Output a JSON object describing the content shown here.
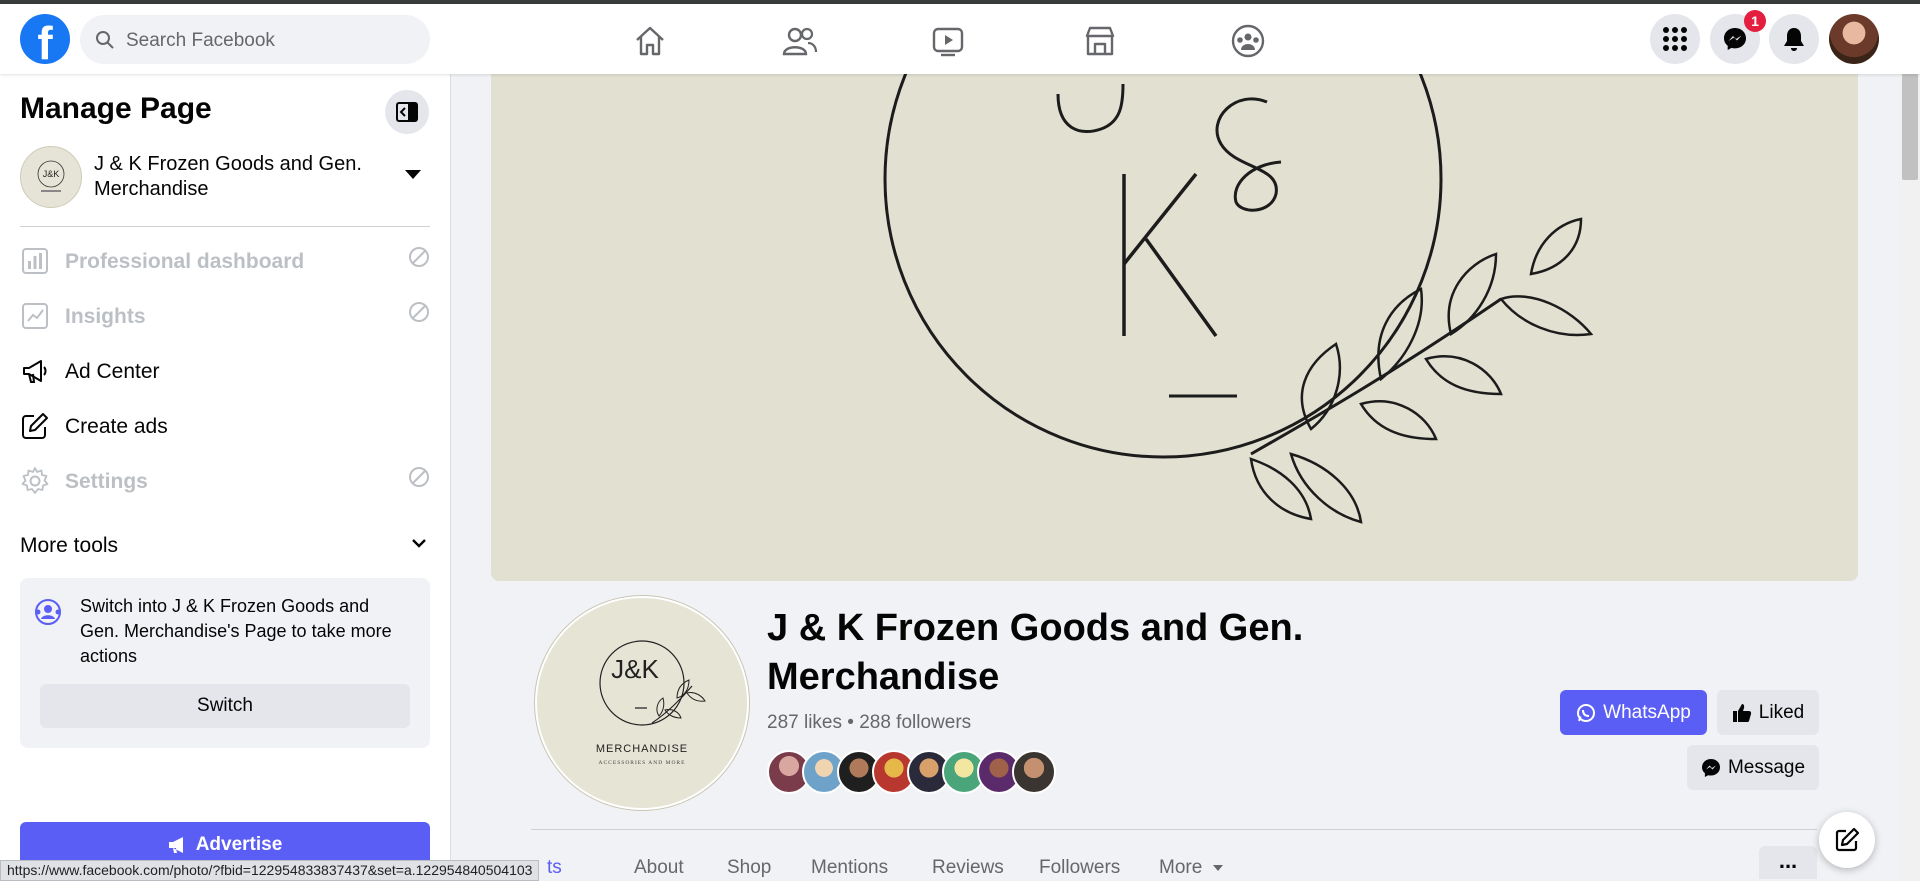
{
  "search": {
    "placeholder": "Search Facebook"
  },
  "navbar": {
    "icons": [
      "home-icon",
      "friends-icon",
      "watch-icon",
      "marketplace-icon",
      "groups-icon"
    ],
    "messenger_badge": "1"
  },
  "sidebar": {
    "title": "Manage Page",
    "page_name": "J & K Frozen Goods and Gen. Merchandise",
    "items": [
      {
        "label": "Professional dashboard",
        "icon": "dashboard-icon",
        "disabled": true
      },
      {
        "label": "Insights",
        "icon": "insights-icon",
        "disabled": true
      },
      {
        "label": "Ad Center",
        "icon": "megaphone-icon",
        "disabled": false
      },
      {
        "label": "Create ads",
        "icon": "edit-icon",
        "disabled": false
      },
      {
        "label": "Settings",
        "icon": "gear-icon",
        "disabled": true
      }
    ],
    "more_tools": "More tools",
    "switch_text": "Switch into J & K Frozen Goods and Gen. Merchandise's Page to take more actions",
    "switch_button": "Switch",
    "advertise_button": "Advertise"
  },
  "status_url": "https://www.facebook.com/photo/?fbid=122954833837437&set=a.122954840504103",
  "profile": {
    "logo_text": "J&K",
    "logo_caption": "MERCHANDISE",
    "logo_subcaption": "ACCESSORIES AND MORE",
    "name": "J & K Frozen Goods and Gen. Merchandise",
    "stats": "287 likes • 288 followers",
    "whatsapp_button": "WhatsApp",
    "liked_button": "Liked",
    "message_button": "Message"
  },
  "tabs": {
    "partial": "ts",
    "items": [
      "About",
      "Shop",
      "Mentions",
      "Reviews",
      "Followers"
    ],
    "more": "More",
    "dots": "..."
  },
  "colors": {
    "brand": "#1877f2",
    "accent": "#5b5ef5",
    "cover_bg": "#e1e0d1",
    "badge": "#e41e3f"
  }
}
